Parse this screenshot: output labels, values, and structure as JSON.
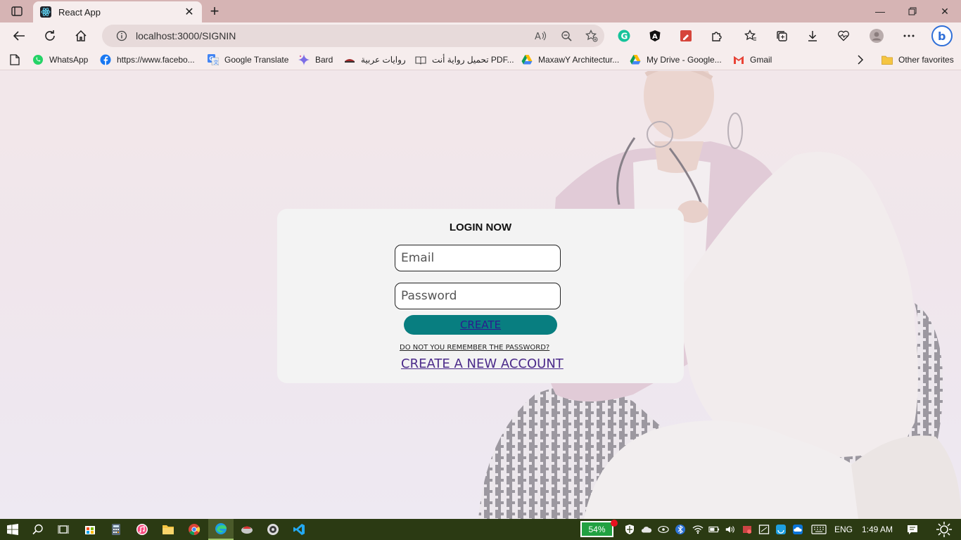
{
  "browser": {
    "tab": {
      "title": "React App"
    },
    "address": {
      "url": "localhost:3000/SIGNIN"
    }
  },
  "favorites": [
    {
      "label": "WhatsApp",
      "icon": "whatsapp-icon"
    },
    {
      "label": "https://www.facebo...",
      "icon": "facebook-icon"
    },
    {
      "label": "Google Translate",
      "icon": "google-translate-icon"
    },
    {
      "label": "Bard",
      "icon": "bard-icon"
    },
    {
      "label": "روايات عربية",
      "icon": "book-icon"
    },
    {
      "label": "تحميل رواية أنت PDF...",
      "icon": "book-open-icon"
    },
    {
      "label": "MaxawY Architectur...",
      "icon": "google-drive-icon"
    },
    {
      "label": "My Drive - Google...",
      "icon": "google-drive-icon"
    },
    {
      "label": "Gmail",
      "icon": "gmail-icon"
    }
  ],
  "other_favorites": "Other favorites",
  "login": {
    "title": "LOGIN NOW",
    "email_placeholder": "Email",
    "password_placeholder": "Password",
    "create_label": "CREATE",
    "forgot_label": "DO NOT YOU REMEMBER THE PASSWORD?",
    "new_account_label": "CREATE A NEW ACCOUNT"
  },
  "taskbar": {
    "battery": "54%",
    "language": "ENG",
    "time": "1:49 AM"
  },
  "colors": {
    "accent_button": "#087e80",
    "link": "#4b2a8a",
    "titlebar": "#d6b4b4",
    "taskbar": "#2b3a13"
  }
}
